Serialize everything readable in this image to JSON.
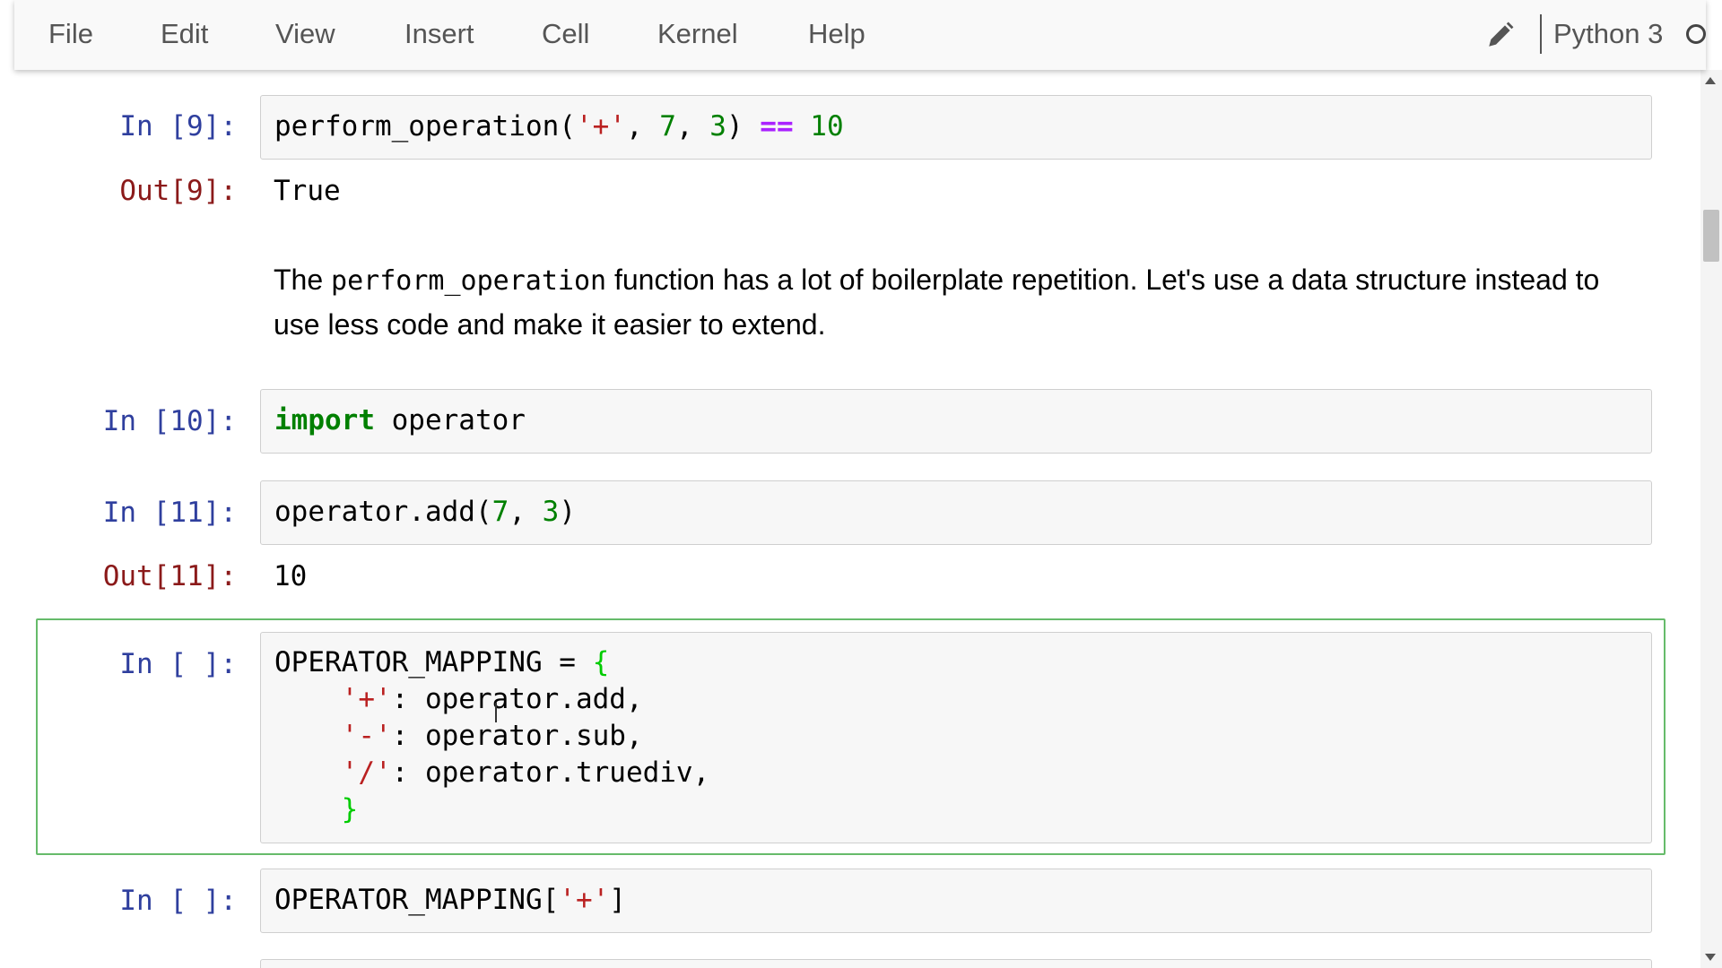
{
  "menubar": {
    "items": [
      "File",
      "Edit",
      "View",
      "Insert",
      "Cell",
      "Kernel",
      "Help"
    ],
    "kernel_name": "Python 3",
    "edit_icon": "pencil-icon",
    "status_icon": "kernel-idle-circle-icon"
  },
  "cells": {
    "c9": {
      "in_prompt": "In [9]:",
      "out_prompt": "Out[9]:",
      "output": "True"
    },
    "md": {
      "text_before": "The ",
      "code": "perform_operation",
      "text_after": " function has a lot of boilerplate repetition. Let's use a data structure instead to use less code and make it easier to extend."
    },
    "c10": {
      "in_prompt": "In [10]:"
    },
    "c11": {
      "in_prompt": "In [11]:",
      "out_prompt": "Out[11]:",
      "output": "10"
    },
    "c12": {
      "in_prompt": "In [ ]:"
    },
    "c13": {
      "in_prompt": "In [ ]:"
    }
  },
  "colors": {
    "keyword": "#008000",
    "string": "#ba2121",
    "number": "#008000",
    "operator": "#aa22ff",
    "brace": "#00cc00",
    "in_prompt": "#2f3f9e",
    "out_prompt": "#8b1a1a",
    "selected_border": "#66bb6a"
  }
}
